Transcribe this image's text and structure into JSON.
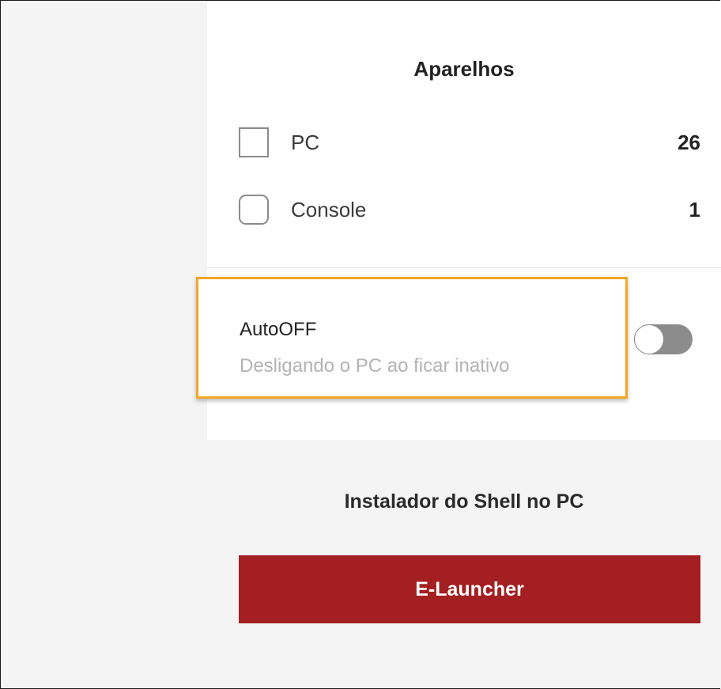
{
  "devices_section": {
    "title": "Aparelhos",
    "items": [
      {
        "label": "PC",
        "count": "26",
        "checked": false
      },
      {
        "label": "Console",
        "count": "1",
        "checked": false
      }
    ]
  },
  "autooff": {
    "title": "AutoOFF",
    "description": "Desligando o PC ao ficar inativo",
    "enabled": false,
    "highlight_color": "#f5a623"
  },
  "installer": {
    "label": "Instalador do Shell no PC",
    "button_label": "E-Launcher",
    "button_color": "#a31f21"
  }
}
